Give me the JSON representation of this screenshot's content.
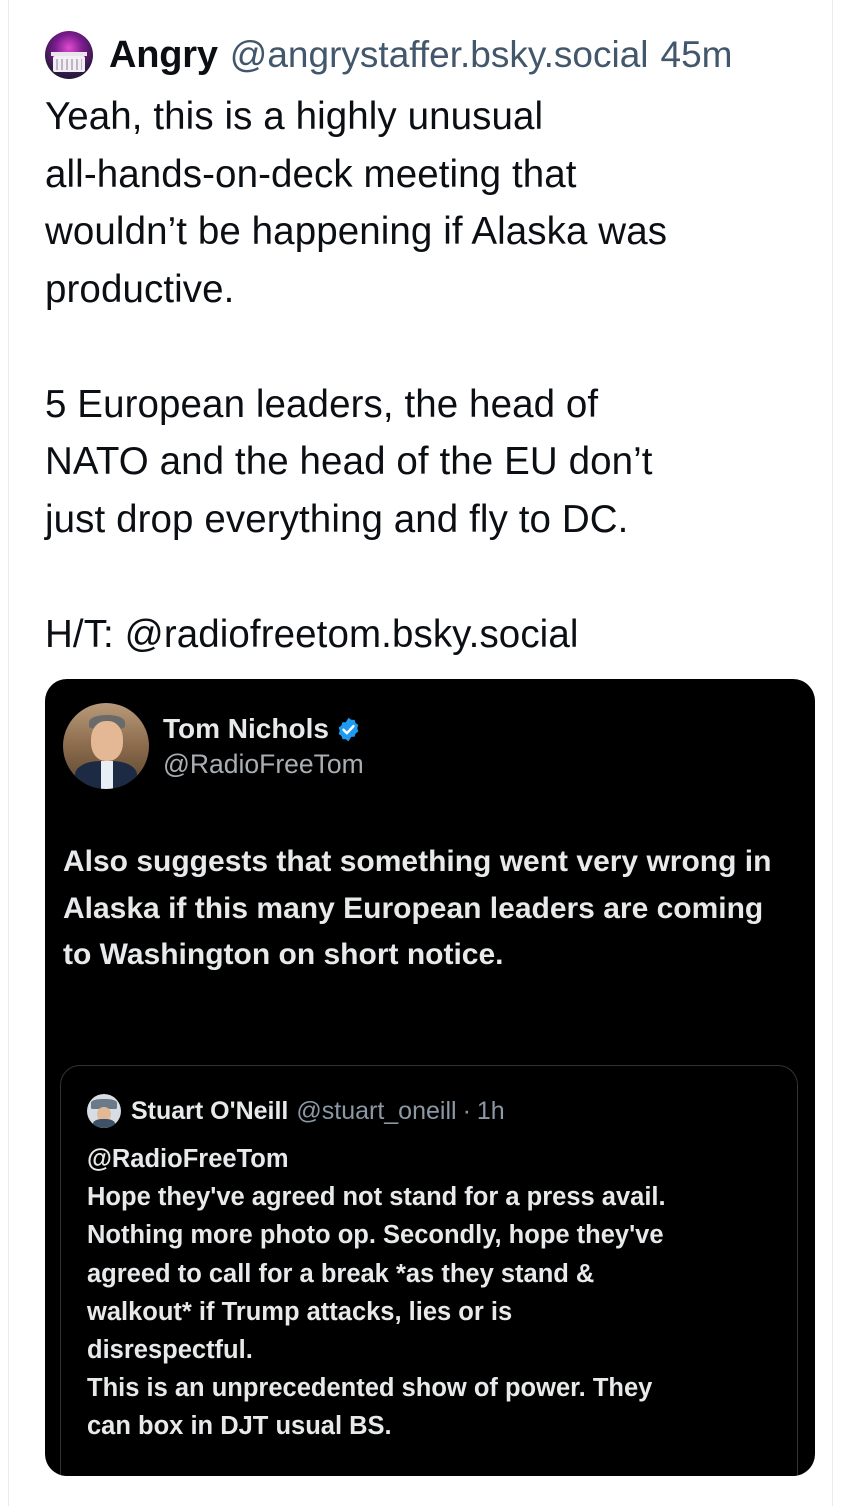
{
  "post": {
    "author_name": "Angry",
    "author_handle": "@angrystaffer.bsky.social",
    "time": "45m",
    "text": "Yeah, this is a highly unusual\nall-hands-on-deck meeting that\nwouldn’t be happening if Alaska was\nproductive.\n\n5 European leaders, the head of\nNATO and the head of the EU don’t\njust drop everything and fly to DC.\n\nH/T: @radiofreetom.bsky.social"
  },
  "quoted_tweet": {
    "author_name": "Tom Nichols",
    "author_handle": "@RadioFreeTom",
    "verified": true,
    "text": "Also suggests that something went very wrong in Alaska if this many European leaders are coming to Washington on short notice."
  },
  "inner_quote": {
    "author_name": "Stuart O'Neill",
    "author_handle": "@stuart_oneill",
    "separator": "·",
    "time": "1h",
    "text": "@RadioFreeTom\nHope they've agreed not stand for a press avail.\nNothing  more photo op. Secondly, hope they've\nagreed to call for a break *as they stand &\nwalkout* if Trump attacks, lies or is\ndisrespectful.\nThis is an unprecedented show of power. They\ncan box in DJT usual BS."
  },
  "colors": {
    "accent_verified": "#1d9bf0",
    "muted_text": "#42576c",
    "dark_card": "#000000"
  }
}
